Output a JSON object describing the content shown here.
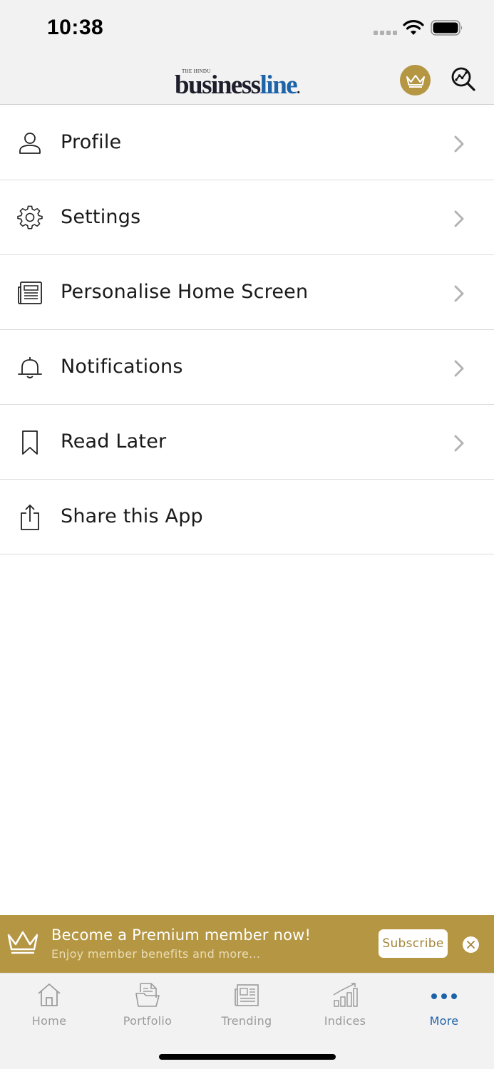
{
  "status_bar": {
    "time": "10:38"
  },
  "header": {
    "logo_top": "THE HINDU",
    "logo_business": "business",
    "logo_line": "line",
    "logo_dot": ".",
    "premium_icon": "crown-icon",
    "search_icon": "search-chart-icon"
  },
  "menu": {
    "items": [
      {
        "label": "Profile",
        "icon": "person-icon",
        "has_chevron": true
      },
      {
        "label": "Settings",
        "icon": "gear-icon",
        "has_chevron": true
      },
      {
        "label": "Personalise Home Screen",
        "icon": "newspaper-icon",
        "has_chevron": true
      },
      {
        "label": "Notifications",
        "icon": "bell-icon",
        "has_chevron": true
      },
      {
        "label": "Read Later",
        "icon": "bookmark-icon",
        "has_chevron": true
      },
      {
        "label": "Share this App",
        "icon": "share-icon",
        "has_chevron": false
      }
    ]
  },
  "premium_banner": {
    "title": "Become a Premium member now!",
    "subtitle": "Enjoy member benefits and more...",
    "subscribe_label": "Subscribe",
    "colors": {
      "background": "#b59642",
      "text": "#ffffff"
    }
  },
  "tab_bar": {
    "tabs": [
      {
        "label": "Home",
        "icon": "home-icon",
        "active": false
      },
      {
        "label": "Portfolio",
        "icon": "portfolio-icon",
        "active": false
      },
      {
        "label": "Trending",
        "icon": "newspaper-icon",
        "active": false
      },
      {
        "label": "Indices",
        "icon": "bar-chart-icon",
        "active": false
      },
      {
        "label": "More",
        "icon": "more-dots-icon",
        "active": true
      }
    ],
    "active_color": "#1e63a8",
    "inactive_color": "#9b9b9b"
  }
}
